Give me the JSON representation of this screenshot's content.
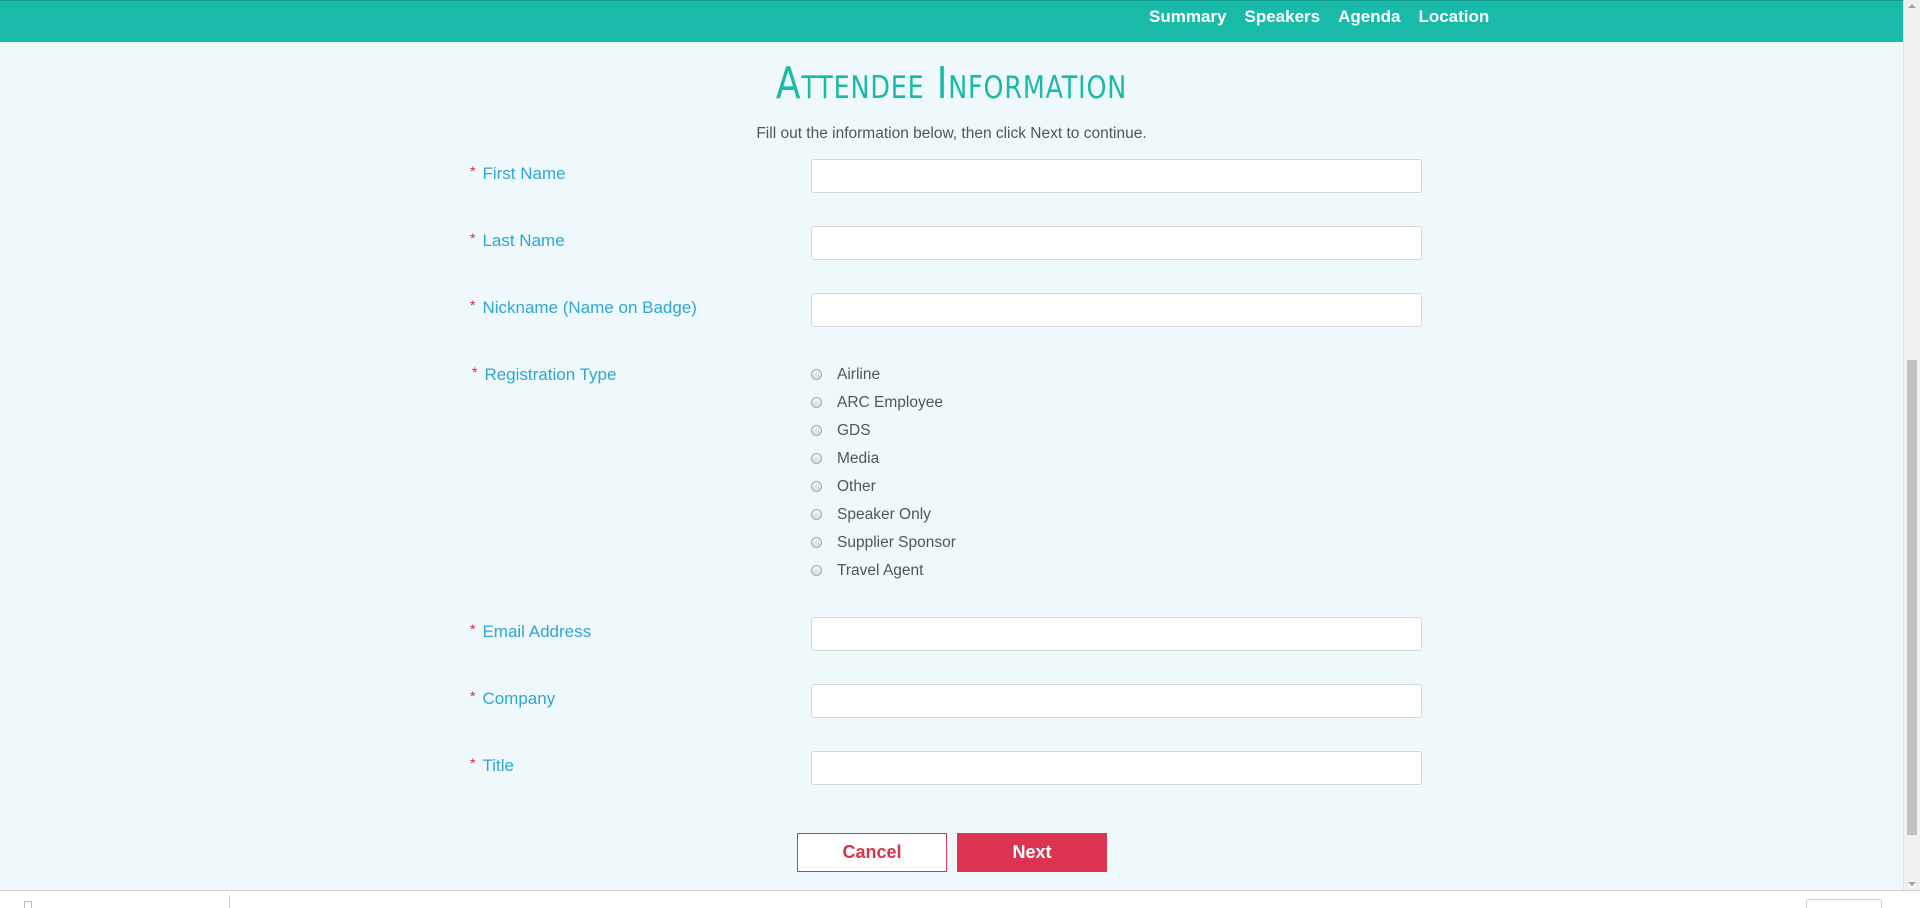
{
  "nav": {
    "items": [
      {
        "label": "Summary"
      },
      {
        "label": "Speakers"
      },
      {
        "label": "Agenda"
      },
      {
        "label": "Location"
      }
    ]
  },
  "header": {
    "title": "Attendee Information",
    "subtitle": "Fill out the information below, then click Next to continue."
  },
  "form": {
    "required_mark": "*",
    "first_name": {
      "label": "First Name",
      "value": "",
      "placeholder": ""
    },
    "last_name": {
      "label": "Last Name",
      "value": "",
      "placeholder": ""
    },
    "nickname": {
      "label": "Nickname (Name on Badge)",
      "value": "",
      "placeholder": ""
    },
    "registration_type": {
      "label": "Registration Type",
      "options": [
        {
          "label": "Airline",
          "selected": false
        },
        {
          "label": "ARC Employee",
          "selected": false
        },
        {
          "label": "GDS",
          "selected": false
        },
        {
          "label": "Media",
          "selected": false
        },
        {
          "label": "Other",
          "selected": false
        },
        {
          "label": "Speaker Only",
          "selected": false
        },
        {
          "label": "Supplier Sponsor",
          "selected": false
        },
        {
          "label": "Travel Agent",
          "selected": false
        }
      ]
    },
    "email": {
      "label": "Email Address",
      "value": "",
      "placeholder": ""
    },
    "company": {
      "label": "Company",
      "value": "",
      "placeholder": ""
    },
    "title": {
      "label": "Title",
      "value": "",
      "placeholder": ""
    }
  },
  "actions": {
    "cancel_label": "Cancel",
    "next_label": "Next"
  },
  "colors": {
    "header_bar": "#1abaa9",
    "label_text": "#2fa6d6",
    "required": "#e0242f",
    "accent_button": "#dc3450",
    "page_background": "#eff8fb"
  }
}
